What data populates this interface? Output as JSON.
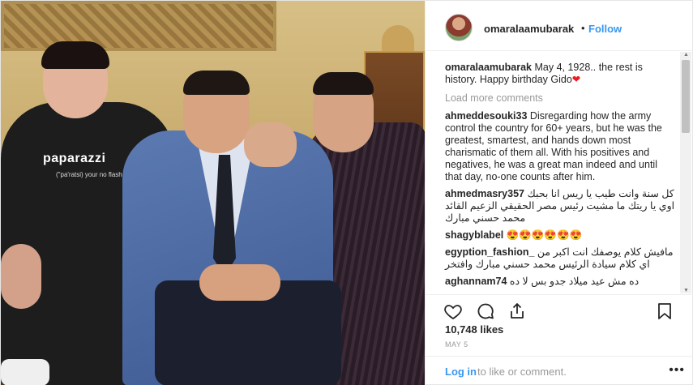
{
  "header": {
    "username": "omaralaamubarak",
    "separator": "•",
    "follow_label": "Follow"
  },
  "photo": {
    "shirt_text": "paparazzi",
    "shirt_subtext": "(\"pa'ratsi) your no flash..."
  },
  "caption": {
    "username": "omaralaamubarak",
    "text": "May 4, 1928.. the rest is history. Happy birthday Gido",
    "emoji": "❤"
  },
  "load_more_label": "Load more comments",
  "comments": [
    {
      "username": "ahmeddesouki33",
      "text": "Disregarding how the army control the country for 60+ years, but he was the greatest, smartest, and hands down most charismatic of them all. With his positives and negatives, he was a great man indeed and until that day, no-one counts after him.",
      "rtl": false
    },
    {
      "username": "ahmedmasry357",
      "text": "كل سنة وانت طيب يا ريس انا بحبك اوي يا ريتك ما مشيت رئيس مصر الحقيقي الزعيم القائد محمد حسني مبارك",
      "rtl": true
    },
    {
      "username": "shagyblabel",
      "text": "😍😍😍😍😍😍",
      "rtl": false
    },
    {
      "username": "egyption_fashion_",
      "text": "مافيش كلام يوصفك انت اكبر من اي كلام سيادة الرئيس محمد حسني مبارك وافتخر",
      "rtl": true
    },
    {
      "username": "aghannam74",
      "text": "ده مش عيد ميلاد جدو بس لا ده",
      "rtl": true
    }
  ],
  "actions": {
    "likes": "10,748 likes",
    "date": "MAY 5",
    "login_label": "Log in",
    "login_rest": "to like or comment.",
    "more_label": "•••"
  }
}
